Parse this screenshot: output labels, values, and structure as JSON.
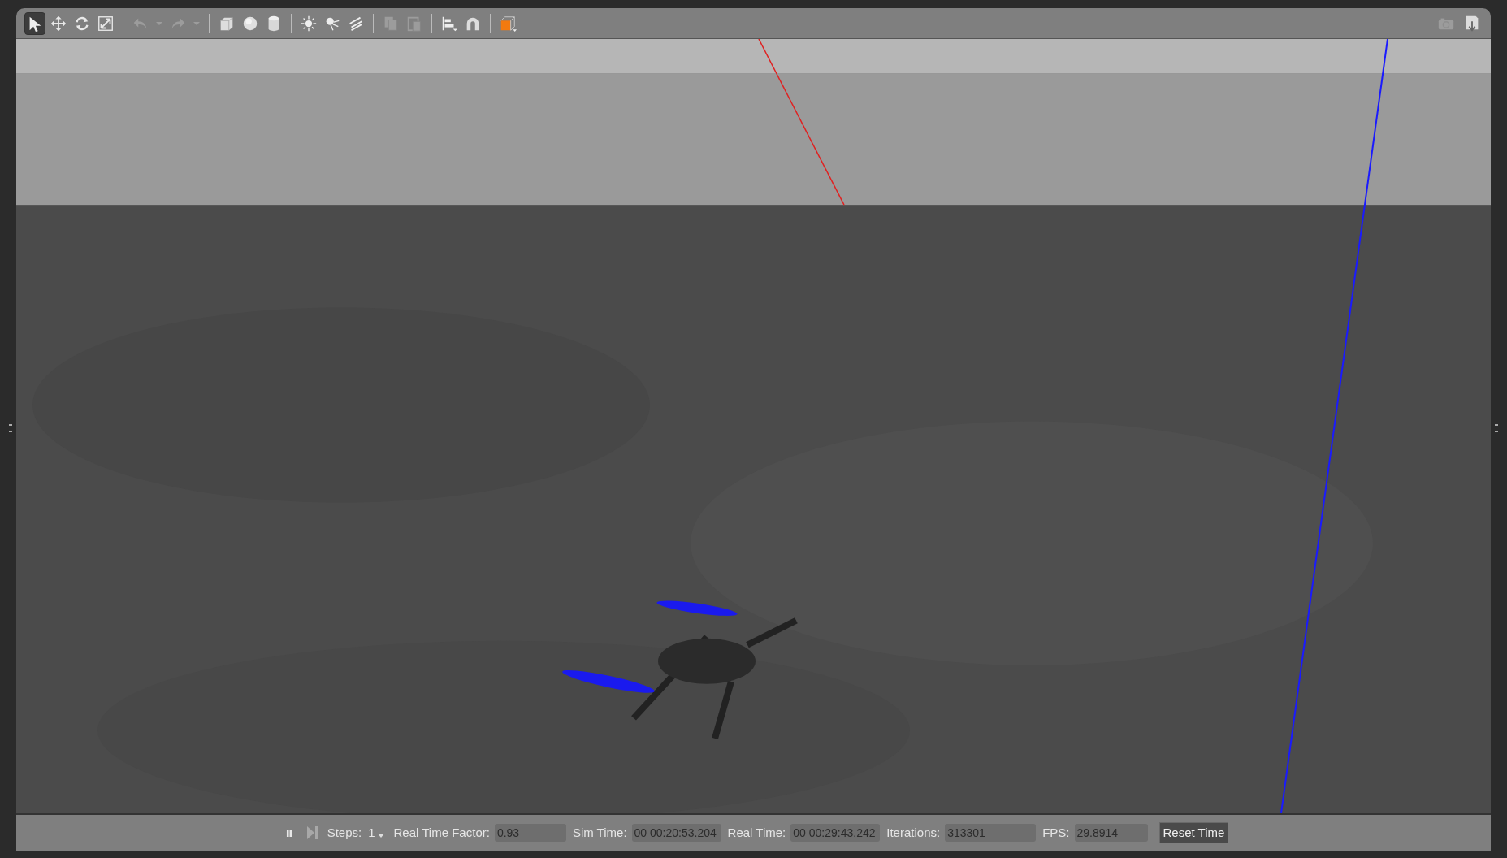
{
  "toolbar": {
    "left": [
      {
        "kind": "select",
        "selected": true,
        "disabled": false
      },
      {
        "kind": "translate",
        "selected": false,
        "disabled": false
      },
      {
        "kind": "rotate",
        "selected": false,
        "disabled": false
      },
      {
        "kind": "scale",
        "selected": false,
        "disabled": false
      },
      {
        "kind": "separator"
      },
      {
        "kind": "undo",
        "selected": false,
        "disabled": true
      },
      {
        "kind": "caret",
        "selected": false,
        "disabled": true
      },
      {
        "kind": "redo",
        "selected": false,
        "disabled": true
      },
      {
        "kind": "caret",
        "selected": false,
        "disabled": true
      },
      {
        "kind": "separator"
      },
      {
        "kind": "box",
        "selected": false,
        "disabled": false
      },
      {
        "kind": "sphere",
        "selected": false,
        "disabled": false
      },
      {
        "kind": "cylinder",
        "selected": false,
        "disabled": false
      },
      {
        "kind": "separator"
      },
      {
        "kind": "sun",
        "selected": false,
        "disabled": false
      },
      {
        "kind": "spot",
        "selected": false,
        "disabled": false
      },
      {
        "kind": "directional",
        "selected": false,
        "disabled": false
      },
      {
        "kind": "separator"
      },
      {
        "kind": "copy",
        "selected": false,
        "disabled": true
      },
      {
        "kind": "paste",
        "selected": false,
        "disabled": true
      },
      {
        "kind": "separator"
      },
      {
        "kind": "align",
        "selected": false,
        "disabled": false
      },
      {
        "kind": "magnet",
        "selected": false,
        "disabled": false
      },
      {
        "kind": "separator"
      },
      {
        "kind": "view",
        "selected": false,
        "disabled": false
      }
    ],
    "right": [
      {
        "kind": "camera",
        "selected": false,
        "disabled": true
      },
      {
        "kind": "log",
        "selected": false,
        "disabled": false
      }
    ]
  },
  "status_bar": {
    "play_pause": "⏸",
    "step_disabled": true,
    "steps_label": "Steps:",
    "steps_value": "1",
    "fields": [
      {
        "label": "Real Time Factor:",
        "value": "0.93"
      },
      {
        "label": "Sim Time:",
        "value": "00 00:20:53.204"
      },
      {
        "label": "Real Time:",
        "value": "00 00:29:43.242"
      },
      {
        "label": "Iterations:",
        "value": "313301"
      },
      {
        "label": "FPS:",
        "value": "29.8914"
      }
    ],
    "reset_button": "Reset Time"
  }
}
